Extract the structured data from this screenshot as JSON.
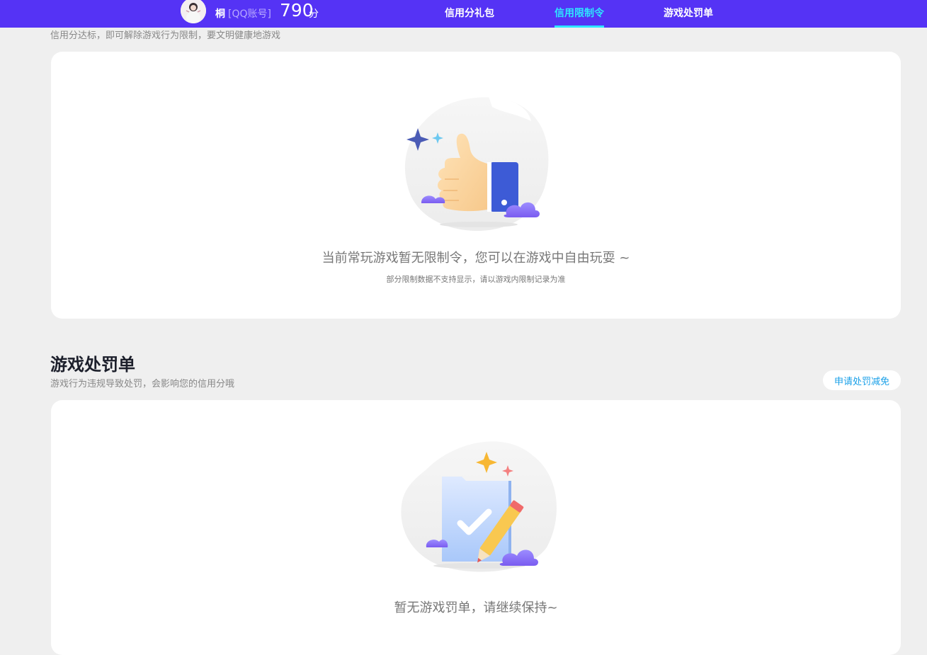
{
  "header": {
    "user_name": "桐",
    "account_type": "[QQ账号]",
    "score": "790",
    "score_unit": "分",
    "tabs": [
      {
        "label": "信用分礼包",
        "active": false
      },
      {
        "label": "信用限制令",
        "active": true
      },
      {
        "label": "游戏处罚单",
        "active": false
      }
    ],
    "colors": {
      "bar": "#5533f5",
      "active_tab": "#2ee6ff"
    }
  },
  "restriction_section": {
    "description": "信用分达标，即可解除游戏行为限制，要文明健康地游戏",
    "empty_title": "当前常玩游戏暂无限制令，您可以在游戏中自由玩耍 ~",
    "empty_note": "部分限制数据不支持显示，请以游戏内限制记录为准",
    "illustration": "thumbs-up-illustration"
  },
  "penalty_section": {
    "title": "游戏处罚单",
    "description": "游戏行为违规导致处罚，会影响您的信用分哦",
    "appeal_button": "申请处罚减免",
    "empty_title": "暂无游戏罚单，请继续保持~",
    "illustration": "folder-check-pencil-illustration"
  }
}
